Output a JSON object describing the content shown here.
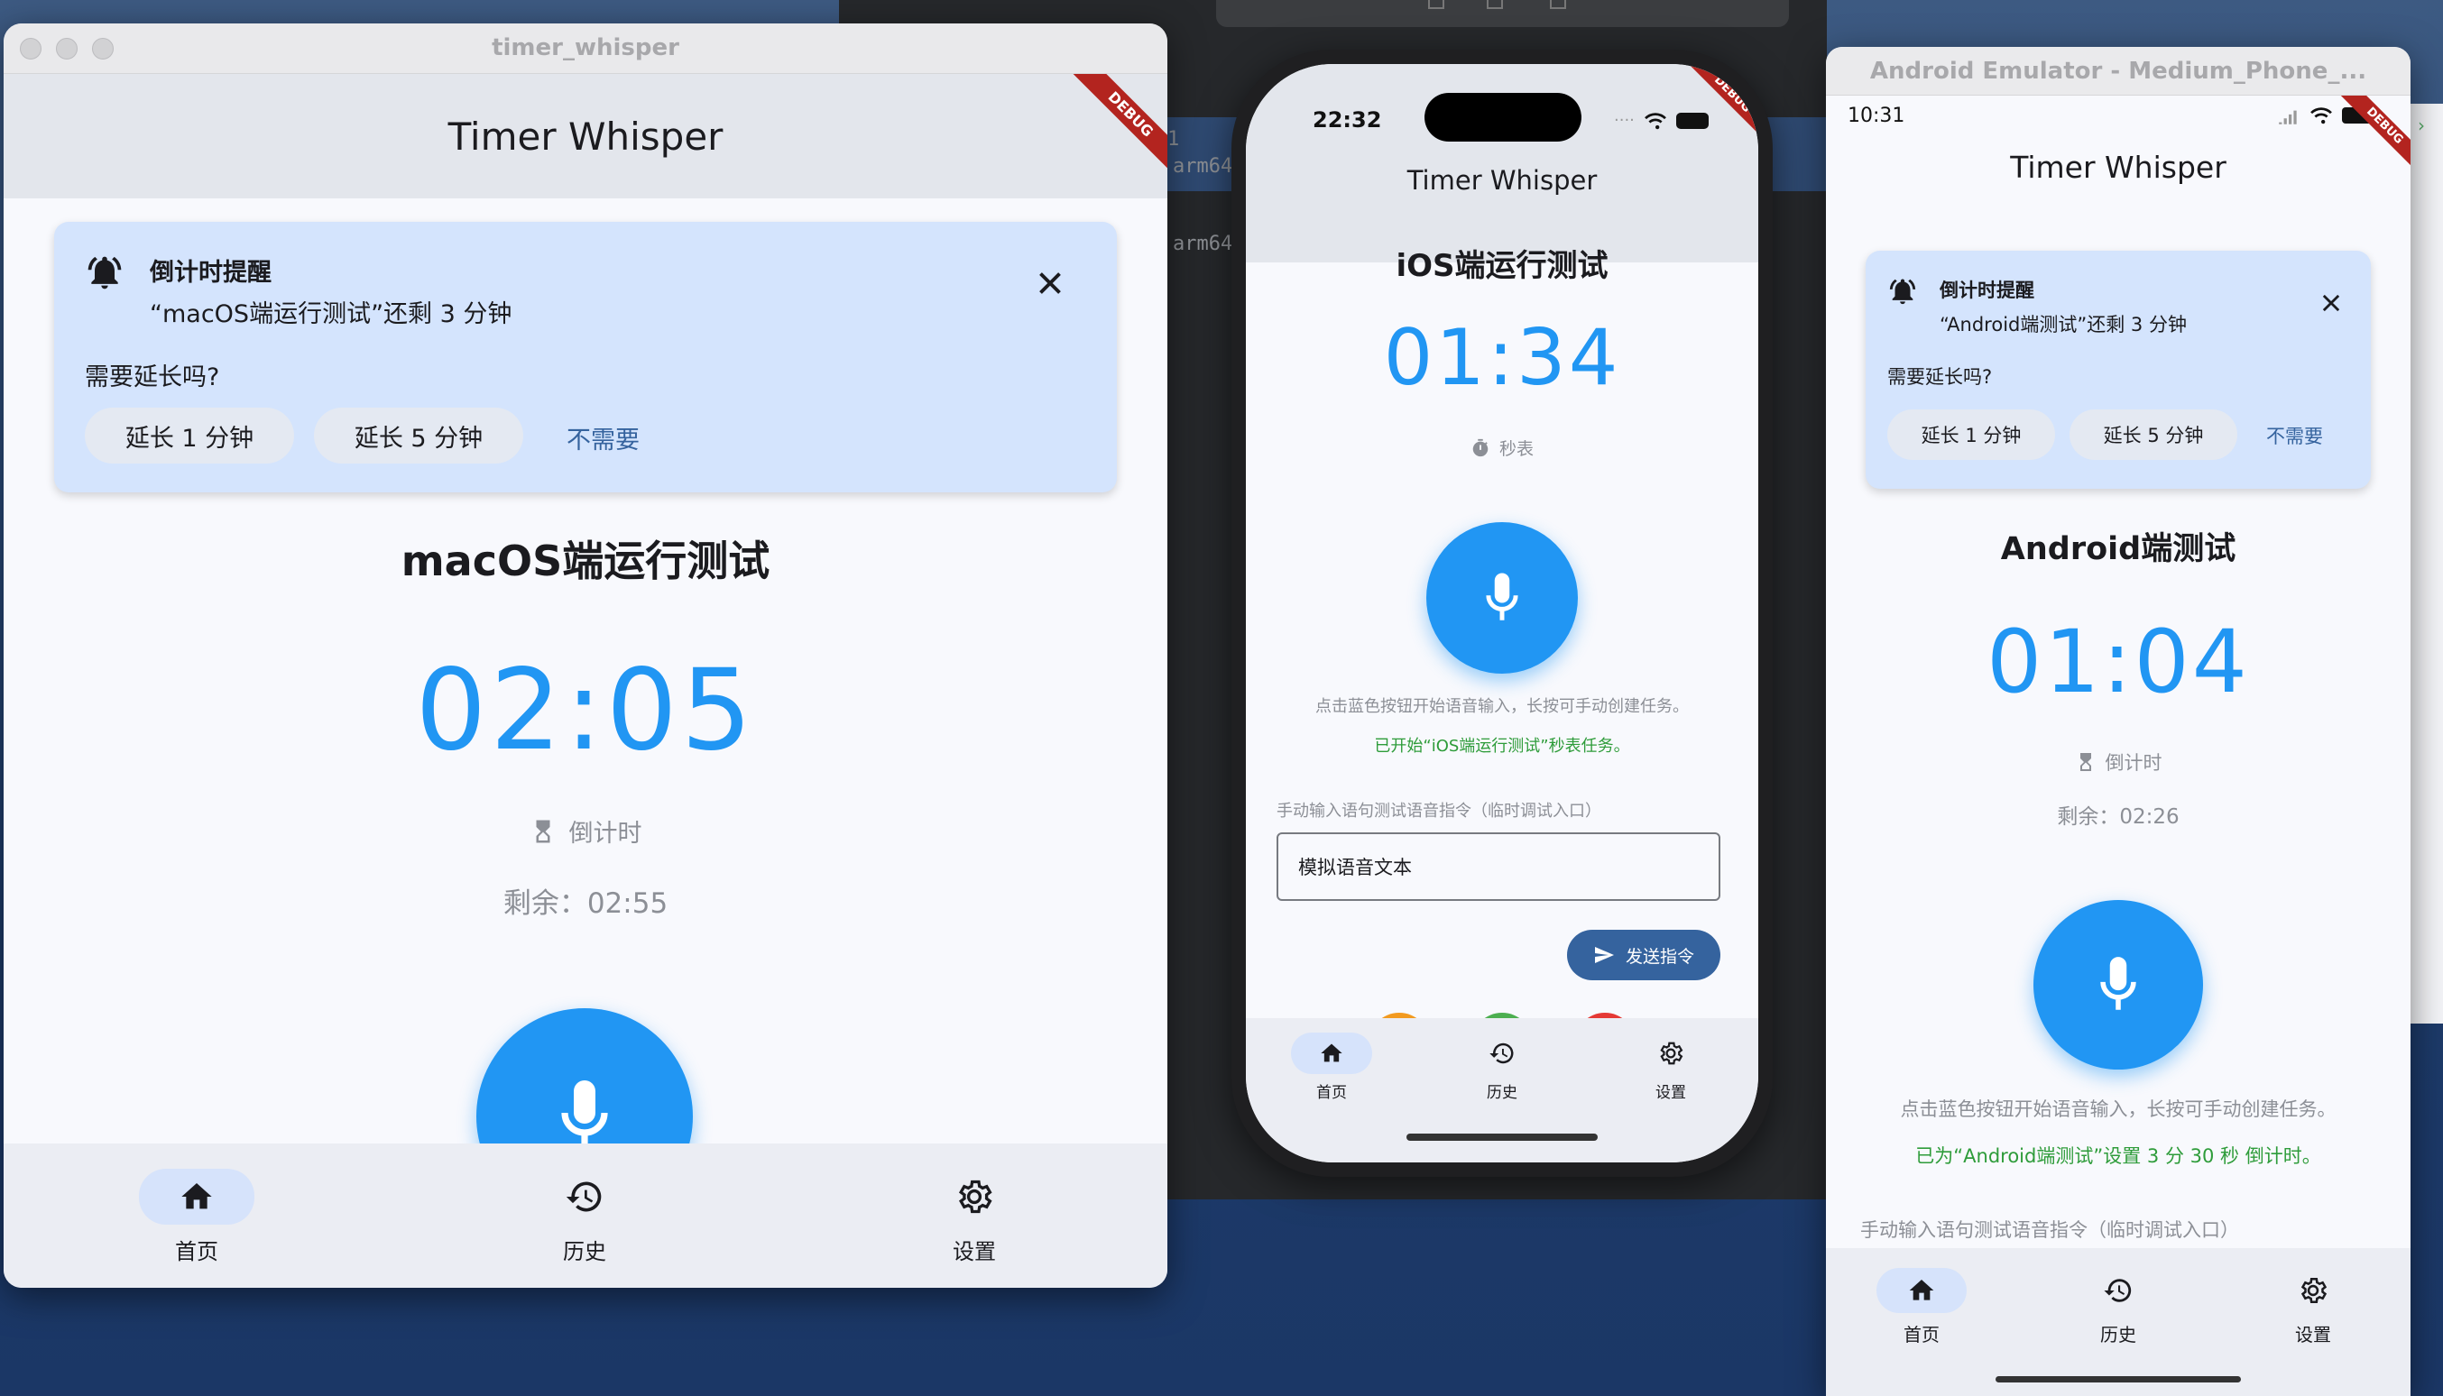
{
  "desktop": {
    "text_1": "1",
    "text_arm64_a": "arm64",
    "text_arm64_b": "arm64"
  },
  "colors": {
    "primary": "#2196f3",
    "timer_blue": "#2196f3",
    "notice_bg": "#d4e4fd",
    "success_green": "#2e9c3a",
    "debug_red": "#b3241f",
    "link": "#35639e"
  },
  "mac": {
    "window_title": "timer_whisper",
    "app_title": "Timer Whisper",
    "debug_label": "DEBUG",
    "notice": {
      "icon": "bell-ring-icon",
      "title": "倒计时提醒",
      "message": "“macOS端运行测试”还剩 3 分钟",
      "question": "需要延长吗?",
      "extend_1": "延长 1 分钟",
      "extend_5": "延长 5 分钟",
      "dismiss": "不需要",
      "close_icon": "close-icon"
    },
    "task_name": "macOS端运行测试",
    "time": "02:05",
    "mode_icon": "hourglass-icon",
    "mode_label": "倒计时",
    "remaining": "剩余：02:55",
    "mic_icon": "microphone-icon",
    "nav": [
      {
        "icon": "home-icon",
        "label": "首页",
        "active": true
      },
      {
        "icon": "history-icon",
        "label": "历史",
        "active": false
      },
      {
        "icon": "settings-gear-icon",
        "label": "设置",
        "active": false
      }
    ]
  },
  "ios": {
    "status_time": "22:32",
    "app_title": "Timer Whisper",
    "debug_label": "DEBUG",
    "task_name": "iOS端运行测试",
    "time": "01:34",
    "mode_icon": "stopwatch-icon",
    "mode_label": "秒表",
    "hint": "点击蓝色按钮开始语音输入，长按可手动创建任务。",
    "status_message": "已开始“iOS端运行测试”秒表任务。",
    "manual_label": "手动输入语句测试语音指令（临时调试入口）",
    "input_value": "模拟语音文本",
    "send_label": "发送指令",
    "send_icon": "send-icon",
    "nav": [
      {
        "icon": "home-icon",
        "label": "首页",
        "active": true
      },
      {
        "icon": "history-icon",
        "label": "历史",
        "active": false
      },
      {
        "icon": "settings-gear-icon",
        "label": "设置",
        "active": false
      }
    ]
  },
  "android": {
    "window_title": "Android Emulator - Medium_Phone_...",
    "status_time": "10:31",
    "app_title": "Timer Whisper",
    "debug_label": "DEBUG",
    "notice": {
      "icon": "bell-ring-icon",
      "title": "倒计时提醒",
      "message": "“Android端测试”还剩 3 分钟",
      "question": "需要延长吗?",
      "extend_1": "延长 1 分钟",
      "extend_5": "延长 5 分钟",
      "dismiss": "不需要",
      "close_icon": "close-icon"
    },
    "task_name": "Android端测试",
    "time": "01:04",
    "mode_icon": "hourglass-icon",
    "mode_label": "倒计时",
    "remaining": "剩余：02:26",
    "hint": "点击蓝色按钮开始语音输入，长按可手动创建任务。",
    "status_message": "已为“Android端测试”设置 3 分 30 秒 倒计时。",
    "manual_label": "手动输入语句测试语音指令（临时调试入口）",
    "nav": [
      {
        "icon": "home-icon",
        "label": "首页",
        "active": true
      },
      {
        "icon": "history-icon",
        "label": "历史",
        "active": false
      },
      {
        "icon": "settings-gear-icon",
        "label": "设置",
        "active": false
      }
    ]
  }
}
